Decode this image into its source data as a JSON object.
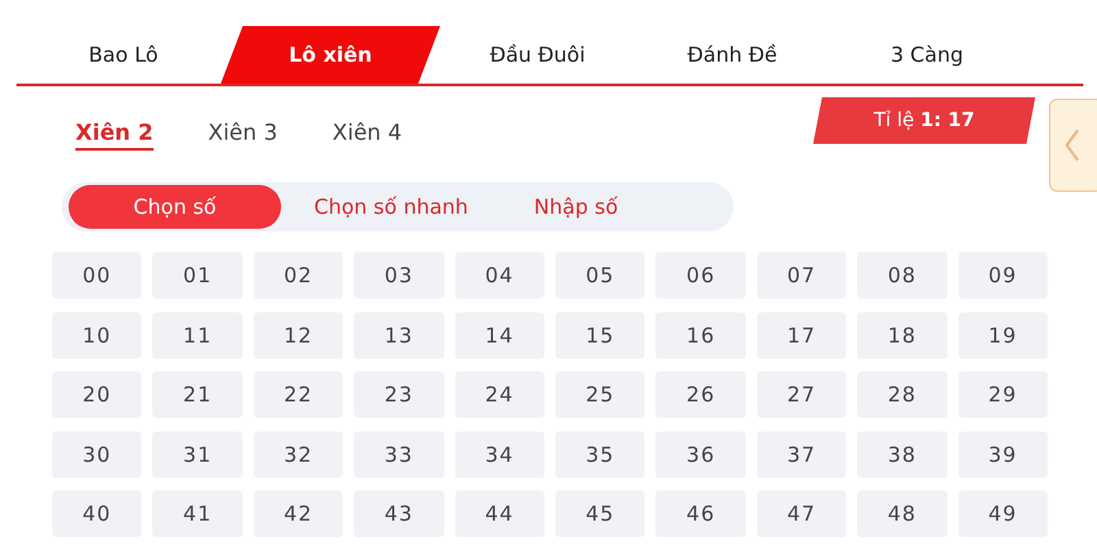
{
  "tabs": [
    {
      "label": "Bao Lô",
      "selected": false
    },
    {
      "label": "Lô xiên",
      "selected": true
    },
    {
      "label": "Đầu Đuôi",
      "selected": false
    },
    {
      "label": "Đánh Đề",
      "selected": false
    },
    {
      "label": "3 Càng",
      "selected": false
    }
  ],
  "subtabs": [
    {
      "label": "Xiên 2",
      "selected": true
    },
    {
      "label": "Xiên 3",
      "selected": false
    },
    {
      "label": "Xiên 4",
      "selected": false
    }
  ],
  "rate": "Tỉ lệ **1: 17**",
  "modes": [
    {
      "label": "Chọn số",
      "selected": true
    },
    {
      "label": "Chọn số nhanh",
      "selected": false
    },
    {
      "label": "Nhập số",
      "selected": false
    }
  ],
  "numbers": [
    [
      "00",
      "01",
      "02",
      "03",
      "04",
      "05",
      "06",
      "07",
      "08",
      "09"
    ],
    [
      "10",
      "11",
      "12",
      "13",
      "14",
      "15",
      "16",
      "17",
      "18",
      "19"
    ],
    [
      "20",
      "21",
      "22",
      "23",
      "24",
      "25",
      "26",
      "27",
      "28",
      "29"
    ],
    [
      "30",
      "31",
      "32",
      "33",
      "34",
      "35",
      "36",
      "37",
      "38",
      "39"
    ],
    [
      "40",
      "41",
      "42",
      "43",
      "44",
      "45",
      "46",
      "47",
      "48",
      "49"
    ]
  ]
}
